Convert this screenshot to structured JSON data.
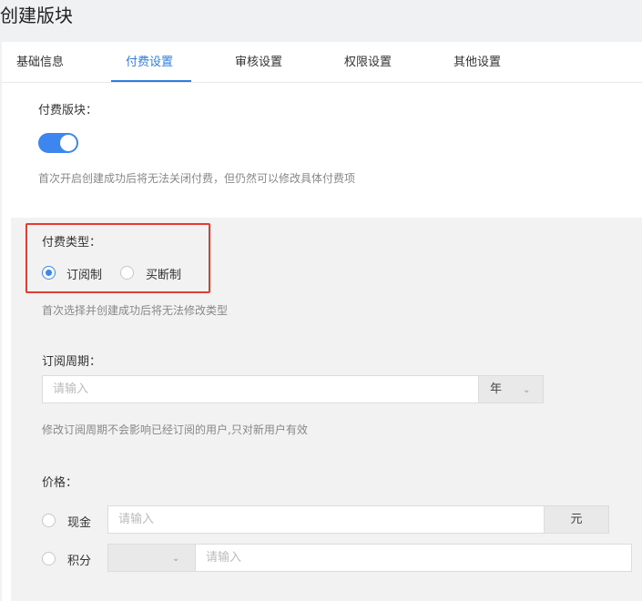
{
  "page": {
    "title": "创建版块"
  },
  "tabs": [
    {
      "label": "基础信息"
    },
    {
      "label": "付费设置"
    },
    {
      "label": "审核设置"
    },
    {
      "label": "权限设置"
    },
    {
      "label": "其他设置"
    }
  ],
  "active_tab": "付费设置",
  "paid_section": {
    "label": "付费版块：",
    "toggle_on": true,
    "hint": "首次开启创建成功后将无法关闭付费，但仍然可以修改具体付费项"
  },
  "pay_type": {
    "label": "付费类型：",
    "options": [
      {
        "label": "订阅制",
        "checked": true
      },
      {
        "label": "买断制",
        "checked": false
      }
    ],
    "hint": "首次选择并创建成功后将无法修改类型"
  },
  "subscription": {
    "label": "订阅周期：",
    "placeholder": "请输入",
    "unit": "年",
    "hint": "修改订阅周期不会影响已经订阅的用户,只对新用户有效"
  },
  "price": {
    "label": "价格：",
    "cash": {
      "label": "现金",
      "placeholder": "请输入",
      "unit": "元"
    },
    "points": {
      "label": "积分",
      "select_value": "",
      "placeholder": "请输入"
    }
  },
  "colors": {
    "accent": "#2f7de1",
    "highlight_box": "#e33a32"
  }
}
